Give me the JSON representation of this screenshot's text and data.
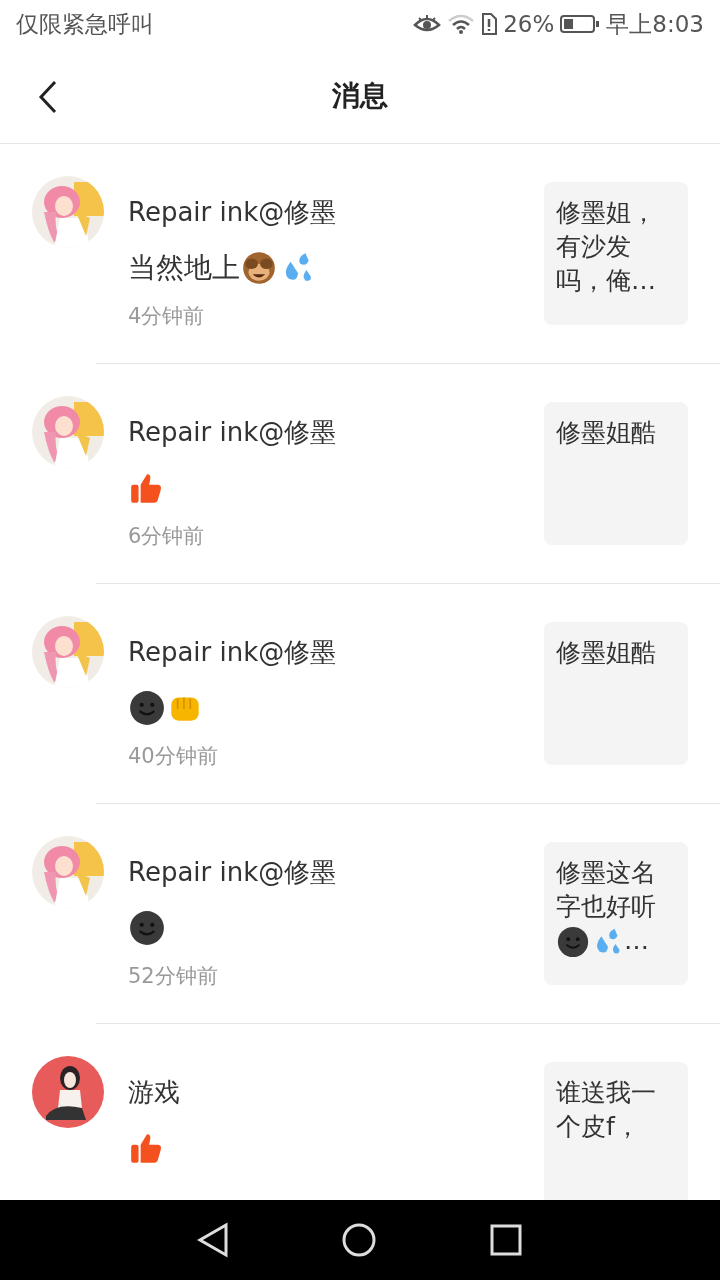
{
  "status_bar": {
    "carrier": "仅限紧急呼叫",
    "battery_text": "26%",
    "time": "早上8:03"
  },
  "header": {
    "title": "消息"
  },
  "messages": [
    {
      "name": "Repair ink@修墨",
      "message": [
        {
          "kind": "text",
          "text": "当然地上"
        },
        {
          "kind": "monkey"
        },
        {
          "kind": "sweat"
        }
      ],
      "time": "4分钟前",
      "preview": [
        {
          "kind": "text",
          "text": "修墨姐，有沙发吗，俺…"
        }
      ]
    },
    {
      "name": "Repair ink@修墨",
      "message": [
        {
          "kind": "thumb"
        }
      ],
      "time": "6分钟前",
      "preview": [
        {
          "kind": "text",
          "text": "修墨姐酷"
        }
      ]
    },
    {
      "name": "Repair ink@修墨",
      "message": [
        {
          "kind": "smiley"
        },
        {
          "kind": "fist"
        }
      ],
      "time": "40分钟前",
      "preview": [
        {
          "kind": "text",
          "text": "修墨姐酷"
        }
      ]
    },
    {
      "name": "Repair ink@修墨",
      "message": [
        {
          "kind": "smiley"
        }
      ],
      "time": "52分钟前",
      "preview": [
        {
          "kind": "text",
          "text": "修墨这名字也好听"
        },
        {
          "kind": "smiley"
        },
        {
          "kind": "sweat"
        },
        {
          "kind": "text",
          "text": "…"
        }
      ]
    },
    {
      "name": "游戏",
      "message": [
        {
          "kind": "thumb"
        }
      ],
      "preview": [
        {
          "kind": "text",
          "text": "谁送我一个皮f，"
        }
      ]
    }
  ]
}
